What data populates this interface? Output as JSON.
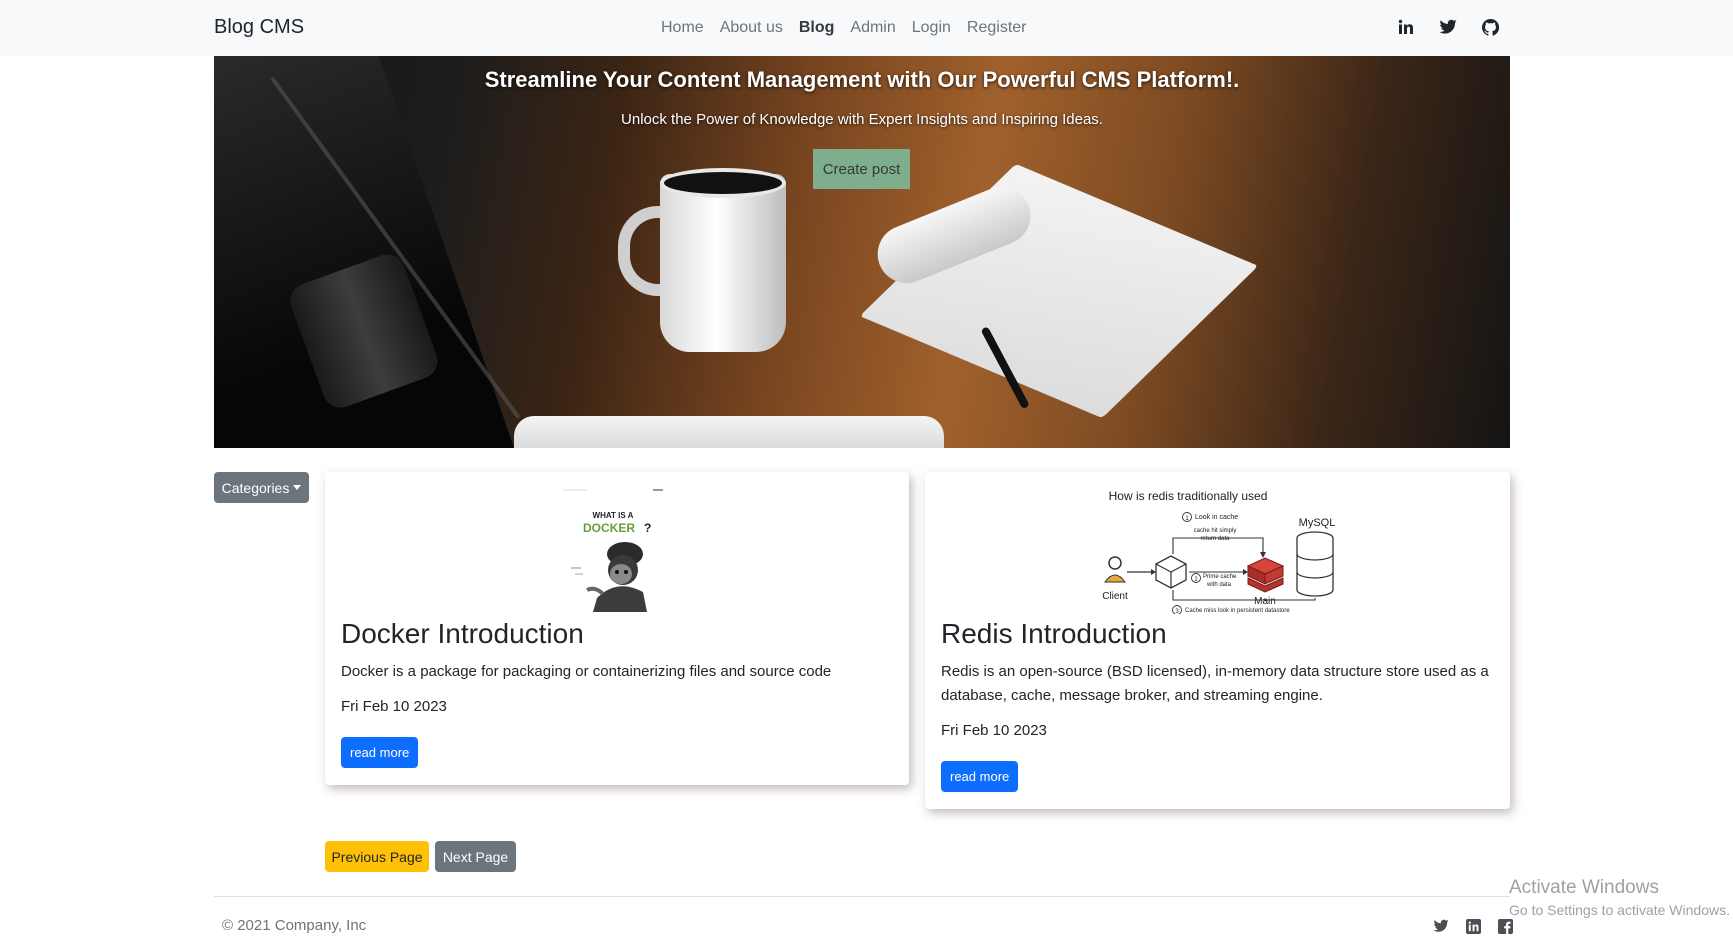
{
  "navbar": {
    "brand": "Blog CMS",
    "links": [
      "Home",
      "About us",
      "Blog",
      "Admin",
      "Login",
      "Register"
    ],
    "active_link": "Blog",
    "social_icons": [
      "linkedin-icon",
      "twitter-icon",
      "github-icon"
    ]
  },
  "hero": {
    "title": "Streamline Your Content Management with Our Powerful CMS Platform!.",
    "subtitle": "Unlock the Power of Knowledge with Expert Insights and Inspiring Ideas.",
    "button_label": "Create post",
    "button_color": "#7fae8e"
  },
  "categories": {
    "label": "Categories"
  },
  "posts": [
    {
      "image_title_line1": "WHAT IS A",
      "image_title_line2": "DOCKER",
      "image_title_suffix": "?",
      "title": "Docker Introduction",
      "excerpt": "Docker is a package for packaging or containerizing files and source code",
      "date": "Fri Feb 10 2023",
      "button_label": "read more"
    },
    {
      "image_heading": "How is redis traditionally used",
      "image_labels": {
        "step1": "Look in cache",
        "cache_hit": "cache hit simply",
        "cache_hit2": "return data",
        "step2": "Prime cache",
        "step2b": "with data",
        "client": "Client",
        "main": "Main",
        "mysql": "MySQL",
        "step3": "Cache miss look in persistent datastore",
        "n1": "1",
        "n2": "2",
        "n3": "3"
      },
      "title": "Redis Introduction",
      "excerpt": "Redis is an open-source (BSD licensed), in-memory data structure store used as a database, cache, message broker, and streaming engine.",
      "date": "Fri Feb 10 2023",
      "button_label": "read more"
    }
  ],
  "pagination": {
    "prev_label": "Previous Page",
    "next_label": "Next Page"
  },
  "footer": {
    "copyright": "© 2021 Company, Inc",
    "social_icons": [
      "twitter-icon",
      "linkedin-icon",
      "facebook-icon"
    ]
  },
  "watermark": {
    "title": "Activate Windows",
    "subtitle": "Go to Settings to activate Windows."
  },
  "colors": {
    "primary": "#0d6efd",
    "secondary": "#6c757d",
    "warning": "#ffc107",
    "navbar_bg": "#f8f9fa"
  }
}
